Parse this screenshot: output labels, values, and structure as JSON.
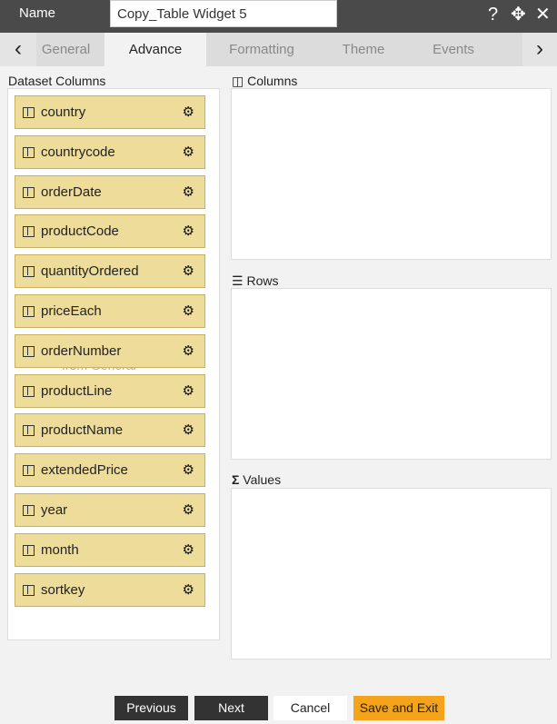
{
  "header": {
    "name_label": "Name",
    "name_value": "Copy_Table Widget 5",
    "icons": [
      "help-icon",
      "move-icon",
      "close-icon"
    ]
  },
  "tabs": [
    {
      "label": "General"
    },
    {
      "label": "Advance",
      "active": true
    },
    {
      "label": "Formatting"
    },
    {
      "label": "Theme"
    },
    {
      "label": "Events"
    }
  ],
  "dataset": {
    "title": "Dataset Columns",
    "items": [
      "country",
      "countrycode",
      "orderDate",
      "productCode",
      "quantityOrdered",
      "priceEach",
      "orderNumber",
      "productLine",
      "productName",
      "extendedPrice",
      "year",
      "month",
      "sortkey"
    ],
    "ghost_text": "from General"
  },
  "drop_zones": {
    "columns": "Columns",
    "rows": "Rows",
    "values": "Values"
  },
  "footer": {
    "previous": "Previous",
    "next": "Next",
    "cancel": "Cancel",
    "save": "Save and Exit"
  },
  "colors": {
    "header": "#4a4a4a",
    "item": "#eedc9a",
    "save": "#f5a31a",
    "dark_button": "#333333"
  }
}
